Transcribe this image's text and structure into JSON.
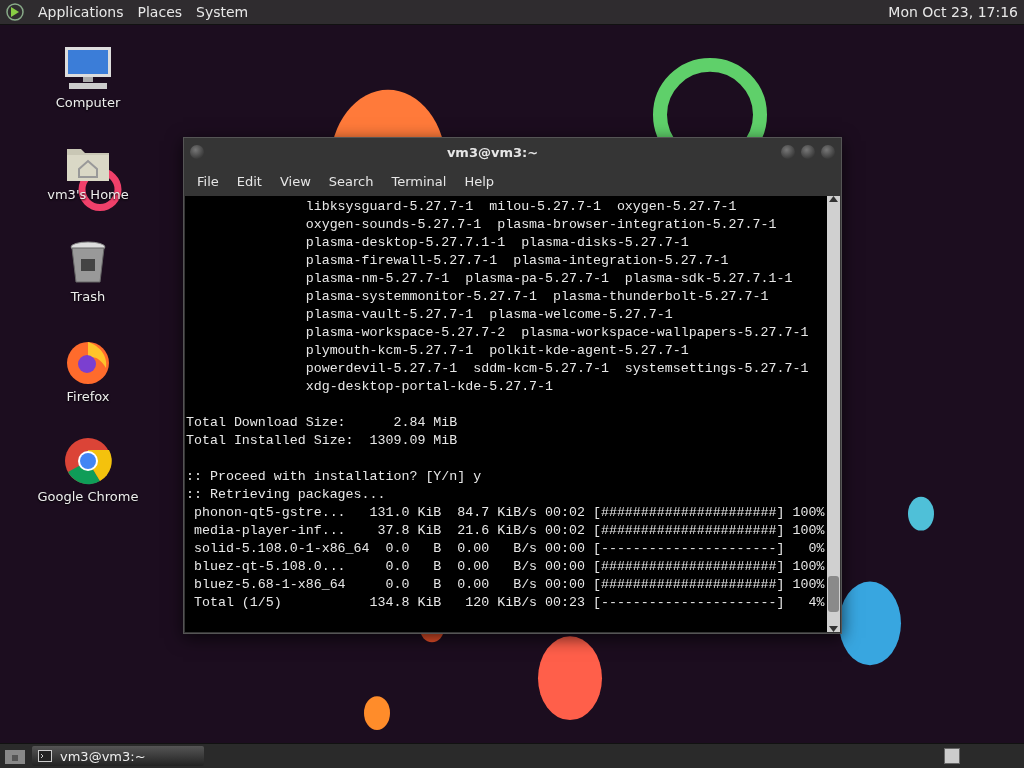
{
  "top_panel": {
    "menus": [
      "Applications",
      "Places",
      "System"
    ],
    "clock": "Mon Oct 23, 17:16"
  },
  "desktop_icons": [
    {
      "label": "Computer",
      "kind": "computer"
    },
    {
      "label": "vm3's Home",
      "kind": "home"
    },
    {
      "label": "Trash",
      "kind": "trash"
    },
    {
      "label": "Firefox",
      "kind": "firefox"
    },
    {
      "label": "Google Chrome",
      "kind": "chrome"
    }
  ],
  "terminal": {
    "title": "vm3@vm3:~",
    "menu": [
      "File",
      "Edit",
      "View",
      "Search",
      "Terminal",
      "Help"
    ],
    "blocks": [
      [
        "               libksysguard-5.27.7-1  milou-5.27.7-1  oxygen-5.27.7-1",
        "               oxygen-sounds-5.27.7-1  plasma-browser-integration-5.27.7-1",
        "               plasma-desktop-5.27.7.1-1  plasma-disks-5.27.7-1",
        "               plasma-firewall-5.27.7-1  plasma-integration-5.27.7-1",
        "               plasma-nm-5.27.7-1  plasma-pa-5.27.7-1  plasma-sdk-5.27.7.1-1",
        "               plasma-systemmonitor-5.27.7-1  plasma-thunderbolt-5.27.7-1",
        "               plasma-vault-5.27.7-1  plasma-welcome-5.27.7-1",
        "               plasma-workspace-5.27.7-2  plasma-workspace-wallpapers-5.27.7-1",
        "               plymouth-kcm-5.27.7-1  polkit-kde-agent-5.27.7-1",
        "               powerdevil-5.27.7-1  sddm-kcm-5.27.7-1  systemsettings-5.27.7-1",
        "               xdg-desktop-portal-kde-5.27.7-1"
      ],
      [
        "Total Download Size:      2.84 MiB",
        "Total Installed Size:  1309.09 MiB"
      ],
      [
        ":: Proceed with installation? [Y/n] y",
        ":: Retrieving packages...",
        " phonon-qt5-gstre...   131.0 KiB  84.7 KiB/s 00:02 [######################] 100%",
        " media-player-inf...    37.8 KiB  21.6 KiB/s 00:02 [######################] 100%",
        " solid-5.108.0-1-x86_64  0.0   B  0.00   B/s 00:00 [----------------------]   0%",
        " bluez-qt-5.108.0...     0.0   B  0.00   B/s 00:00 [######################] 100%",
        " bluez-5.68-1-x86_64     0.0   B  0.00   B/s 00:00 [######################] 100%",
        " Total (1/5)           134.8 KiB   120 KiB/s 00:23 [----------------------]   4%"
      ]
    ]
  },
  "taskbar": {
    "tasks": [
      {
        "label": "vm3@vm3:~",
        "selected": true
      }
    ]
  }
}
